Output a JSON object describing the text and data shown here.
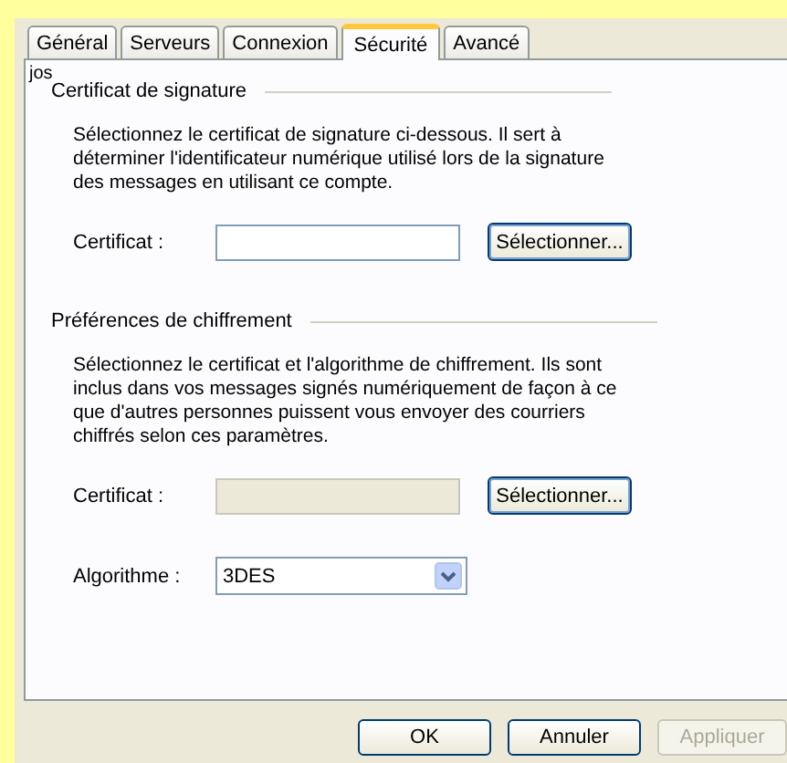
{
  "tabs": [
    {
      "label": "Général",
      "selected": false
    },
    {
      "label": "Serveurs",
      "selected": false
    },
    {
      "label": "Connexion",
      "selected": false
    },
    {
      "label": "Sécurité",
      "selected": true
    },
    {
      "label": "Avancé",
      "selected": false
    }
  ],
  "account_name": "jos",
  "sections": [
    {
      "title": "Certificat de signature",
      "description": "Sélectionnez le certificat de signature ci-dessous. Il sert à déterminer l'identificateur numérique utilisé lors de la signature des messages en utilisant ce compte.",
      "rows": [
        {
          "kind": "picker",
          "label": "Certificat :",
          "disabled": false,
          "button": "Sélectionner..."
        }
      ]
    },
    {
      "title": "Préférences de chiffrement",
      "description": "Sélectionnez le certificat et l'algorithme de chiffrement. Ils sont inclus dans vos messages signés numériquement de façon à ce que d'autres personnes puissent vous envoyer des courriers chiffrés selon ces paramètres.",
      "rows": [
        {
          "kind": "picker",
          "label": "Certificat :",
          "disabled": true,
          "button": "Sélectionner..."
        },
        {
          "kind": "dropdown",
          "label": "Algorithme :",
          "value": "3DES"
        }
      ]
    }
  ],
  "buttons": [
    {
      "label": "OK",
      "disabled": false
    },
    {
      "label": "Annuler",
      "disabled": false
    },
    {
      "label": "Appliquer",
      "disabled": true
    }
  ]
}
